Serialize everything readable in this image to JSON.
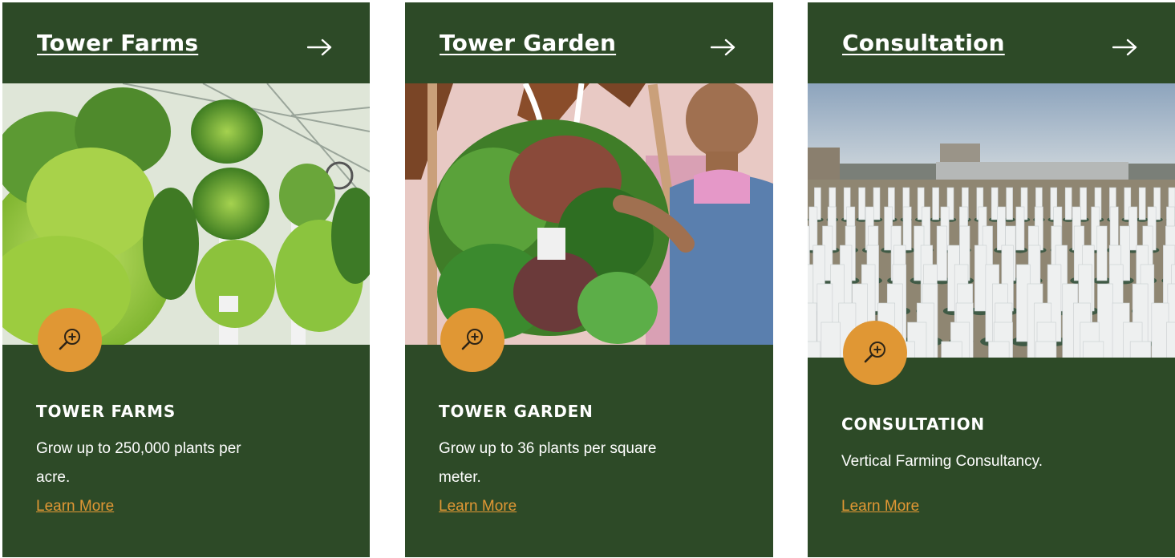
{
  "cards": [
    {
      "title": "Tower Farms",
      "heading": "TOWER FARMS",
      "description": "Grow up to 250,000 plants per acre.",
      "link_label": "Learn More",
      "icons": {
        "header": "arrow-right-icon",
        "zoom": "zoom-in-icon"
      },
      "image": "vertical tower farms with lettuce in greenhouse"
    },
    {
      "title": "Tower Garden",
      "heading": "TOWER GARDEN",
      "description": "Grow up to 36 plants per square meter.",
      "link_label": "Learn More",
      "icons": {
        "header": "arrow-right-icon",
        "zoom": "zoom-in-icon"
      },
      "image": "man tending an indoor tower garden with greens"
    },
    {
      "title": "Consultation",
      "heading": "CONSULTATION",
      "description": "Vertical Farming Consultancy.",
      "link_label": "Learn More",
      "icons": {
        "header": "arrow-right-icon",
        "zoom": "zoom-in-icon"
      },
      "image": "rows of white towers on a city rooftop"
    }
  ],
  "colors": {
    "card_background": "#2d4a27",
    "accent": "#e09734",
    "text": "#ffffff"
  }
}
